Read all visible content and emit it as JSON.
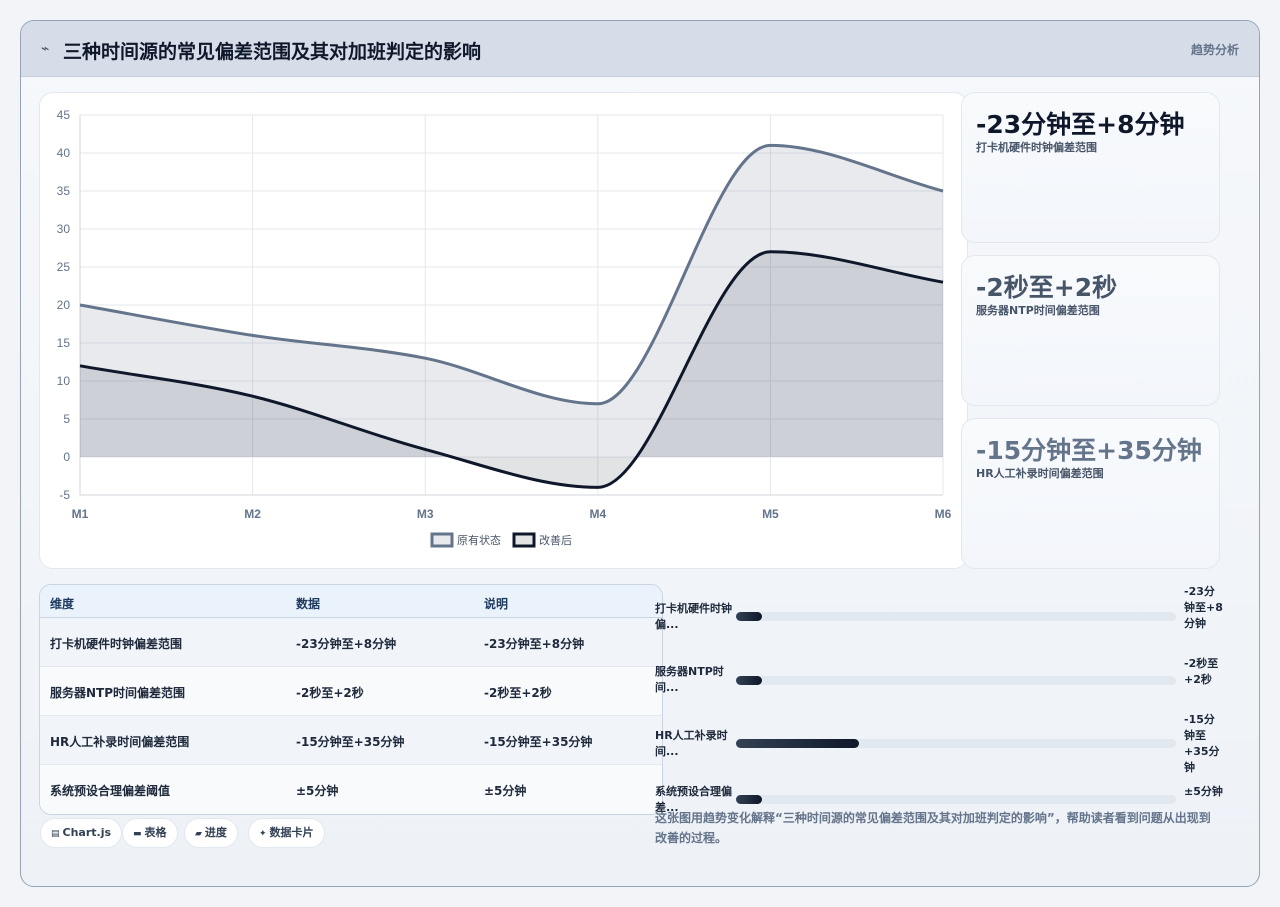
{
  "header": {
    "icon": "pulse-icon",
    "title": "三种时间源的常见偏差范围及其对加班判定的影响",
    "action": "趋势分析"
  },
  "chart_data": {
    "type": "area",
    "categories": [
      "M1",
      "M2",
      "M3",
      "M4",
      "M5",
      "M6"
    ],
    "series": [
      {
        "name": "原有状态",
        "values": [
          20,
          16,
          13,
          7,
          41,
          35
        ],
        "color": "#64748b"
      },
      {
        "name": "改善后",
        "values": [
          12,
          8,
          1,
          -4,
          27,
          23
        ],
        "color": "#0f172a"
      }
    ],
    "yticks": [
      45,
      40,
      35,
      30,
      25,
      20,
      15,
      10,
      5,
      0,
      -5
    ],
    "ylim": [
      -5,
      45
    ],
    "grid": true,
    "legend_position": "bottom"
  },
  "stats": [
    {
      "value": "-23分钟至+8分钟",
      "label": "打卡机硬件时钟偏差范围",
      "color": "#0f172a"
    },
    {
      "value": "-2秒至+2秒",
      "label": "服务器NTP时间偏差范围",
      "color": "#475569"
    },
    {
      "value": "-15分钟至+35分钟",
      "label": "HR人工补录时间偏差范围",
      "color": "#64748b"
    }
  ],
  "table": {
    "headers": [
      "维度",
      "数据",
      "说明"
    ],
    "rows": [
      [
        "打卡机硬件时钟偏差范围",
        "-23分钟至+8分钟",
        "-23分钟至+8分钟"
      ],
      [
        "服务器NTP时间偏差范围",
        "-2秒至+2秒",
        "-2秒至+2秒"
      ],
      [
        "HR人工补录时间偏差范围",
        "-15分钟至+35分钟",
        "-15分钟至+35分钟"
      ],
      [
        "系统预设合理偏差阈值",
        "±5分钟",
        "±5分钟"
      ]
    ]
  },
  "progress": [
    {
      "label": "打卡机硬件时钟偏...",
      "value": "-23分钟至+8分钟",
      "fraction": 0.06
    },
    {
      "label": "服务器NTP时间...",
      "value": "-2秒至+2秒",
      "fraction": 0.06
    },
    {
      "label": "HR人工补录时间...",
      "value": "-15分钟至+35分钟",
      "fraction": 0.28
    },
    {
      "label": "系统预设合理偏差...",
      "value": "±5分钟",
      "fraction": 0.06
    }
  ],
  "chips": [
    {
      "icon": "chart-icon",
      "glyph": "▤",
      "label": "Chart.js"
    },
    {
      "icon": "table-icon",
      "glyph": "▬",
      "label": "表格"
    },
    {
      "icon": "progress-icon",
      "glyph": "▰",
      "label": "进度"
    },
    {
      "icon": "sparkle-icon",
      "glyph": "✦",
      "label": "数据卡片"
    }
  ],
  "caption": "这张图用趋势变化解释“三种时间源的常见偏差范围及其对加班判定的影响”，帮助读者看到问题从出现到改善的过程。"
}
